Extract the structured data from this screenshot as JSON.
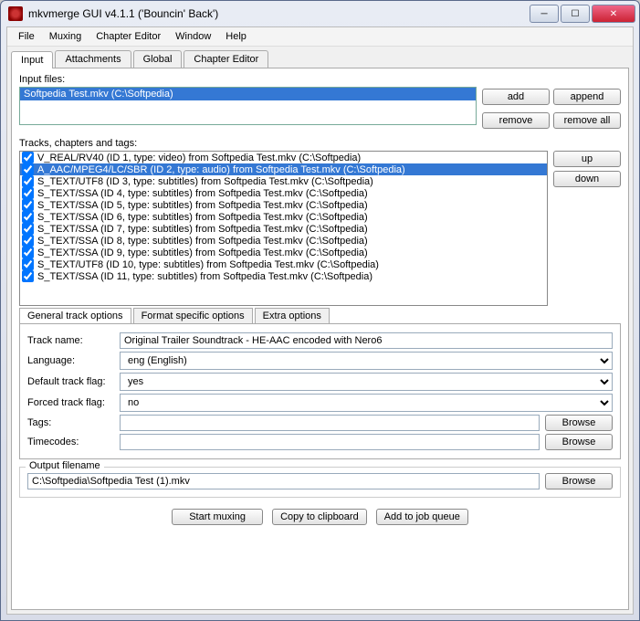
{
  "window": {
    "title": "mkvmerge GUI v4.1.1 ('Bouncin' Back')"
  },
  "menu": [
    "File",
    "Muxing",
    "Chapter Editor",
    "Window",
    "Help"
  ],
  "main_tabs": [
    {
      "label": "Input",
      "active": true
    },
    {
      "label": "Attachments",
      "active": false
    },
    {
      "label": "Global",
      "active": false
    },
    {
      "label": "Chapter Editor",
      "active": false
    }
  ],
  "input_files": {
    "legend": "Input files:",
    "items": [
      {
        "text": "Softpedia Test.mkv (C:\\Softpedia)",
        "selected": true
      }
    ],
    "buttons": {
      "add": "add",
      "append": "append",
      "remove": "remove",
      "remove_all": "remove all"
    }
  },
  "tracks": {
    "legend": "Tracks, chapters and tags:",
    "items": [
      {
        "text": "V_REAL/RV40 (ID 1, type: video) from Softpedia Test.mkv (C:\\Softpedia)",
        "checked": true,
        "selected": false
      },
      {
        "text": "A_AAC/MPEG4/LC/SBR (ID 2, type: audio) from Softpedia Test.mkv (C:\\Softpedia)",
        "checked": true,
        "selected": true
      },
      {
        "text": "S_TEXT/UTF8 (ID 3, type: subtitles) from Softpedia Test.mkv (C:\\Softpedia)",
        "checked": true,
        "selected": false
      },
      {
        "text": "S_TEXT/SSA (ID 4, type: subtitles) from Softpedia Test.mkv (C:\\Softpedia)",
        "checked": true,
        "selected": false
      },
      {
        "text": "S_TEXT/SSA (ID 5, type: subtitles) from Softpedia Test.mkv (C:\\Softpedia)",
        "checked": true,
        "selected": false
      },
      {
        "text": "S_TEXT/SSA (ID 6, type: subtitles) from Softpedia Test.mkv (C:\\Softpedia)",
        "checked": true,
        "selected": false
      },
      {
        "text": "S_TEXT/SSA (ID 7, type: subtitles) from Softpedia Test.mkv (C:\\Softpedia)",
        "checked": true,
        "selected": false
      },
      {
        "text": "S_TEXT/SSA (ID 8, type: subtitles) from Softpedia Test.mkv (C:\\Softpedia)",
        "checked": true,
        "selected": false
      },
      {
        "text": "S_TEXT/SSA (ID 9, type: subtitles) from Softpedia Test.mkv (C:\\Softpedia)",
        "checked": true,
        "selected": false
      },
      {
        "text": "S_TEXT/UTF8 (ID 10, type: subtitles) from Softpedia Test.mkv (C:\\Softpedia)",
        "checked": true,
        "selected": false
      },
      {
        "text": "S_TEXT/SSA (ID 11, type: subtitles) from Softpedia Test.mkv (C:\\Softpedia)",
        "checked": true,
        "selected": false
      }
    ],
    "buttons": {
      "up": "up",
      "down": "down"
    }
  },
  "sub_tabs": [
    {
      "label": "General track options",
      "active": true
    },
    {
      "label": "Format specific options",
      "active": false
    },
    {
      "label": "Extra options",
      "active": false
    }
  ],
  "options": {
    "track_name": {
      "label": "Track name:",
      "value": "Original Trailer Soundtrack - HE-AAC encoded with Nero6"
    },
    "language": {
      "label": "Language:",
      "value": "eng (English)"
    },
    "default_flag": {
      "label": "Default track flag:",
      "value": "yes"
    },
    "forced_flag": {
      "label": "Forced track flag:",
      "value": "no"
    },
    "tags": {
      "label": "Tags:",
      "value": "",
      "browse": "Browse"
    },
    "timecodes": {
      "label": "Timecodes:",
      "value": "",
      "browse": "Browse"
    }
  },
  "output": {
    "legend": "Output filename",
    "value": "C:\\Softpedia\\Softpedia Test (1).mkv",
    "browse": "Browse"
  },
  "bottom_buttons": {
    "start": "Start muxing",
    "copy": "Copy to clipboard",
    "queue": "Add to job queue"
  }
}
